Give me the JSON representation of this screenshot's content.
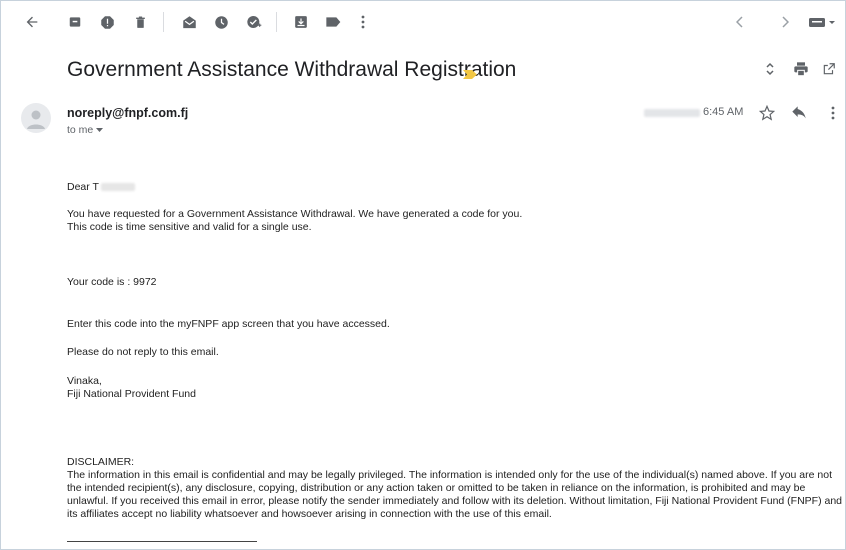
{
  "toolbar": {
    "icons": [
      "back-arrow-icon",
      "archive-icon",
      "report-spam-icon",
      "delete-icon",
      "mark-unread-icon",
      "snooze-icon",
      "add-to-tasks-icon",
      "move-to-icon",
      "labels-icon",
      "more-vert-icon",
      "prev-icon",
      "next-icon",
      "keyboard-icon"
    ]
  },
  "email": {
    "subject": "Government Assistance Withdrawal Registration",
    "sender": "noreply@fnpf.com.fj",
    "to_me": "to me",
    "time": "6:45 AM",
    "greeting": "Dear T",
    "line1": "You have requested for a Government Assistance Withdrawal. We have generated a code for you.",
    "line2": "This code is time sensitive and valid for a single use.",
    "code_line": "Your code is : 9972",
    "enter_line": "Enter this code into the myFNPF app screen that you have accessed.",
    "noreply_line": "Please do not reply to this email.",
    "signoff": "Vinaka,",
    "org": "Fiji National Provident Fund",
    "disclaimer_title": "DISCLAIMER:",
    "disclaimer_text": "The information in this email is confidential and may be legally privileged. The information is intended only for the use of the individual(s) named above. If you are not the intended recipient(s), any disclosure, copying, distribution or any action taken or omitted to be taken in reliance on the information, is prohibited and may be unlawful. If you received this email in error, please notify the sender immediately and follow with its deletion. Without limitation, Fiji National Provident Fund (FNPF) and its affiliates accept no liability whatsoever and howsoever arising in connection with the use of this email."
  },
  "colors": {
    "icon": "#5f6368",
    "importance": "#f2c744",
    "text": "#202124"
  }
}
